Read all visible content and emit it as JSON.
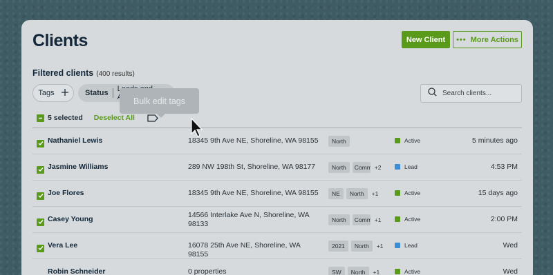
{
  "header": {
    "title": "Clients",
    "new_client_label": "New Client",
    "more_actions_label": "More Actions"
  },
  "filters": {
    "heading": "Filtered clients",
    "count": "(400 results)",
    "tags_label": "Tags",
    "status_key": "Status",
    "status_value": "Leads and Active"
  },
  "search": {
    "placeholder": "Search clients..."
  },
  "tooltip": {
    "text": "Bulk edit tags"
  },
  "selection": {
    "count_label": "5 selected",
    "deselect_label": "Deselect All"
  },
  "colors": {
    "accent": "#5a9a1a",
    "active": "#5a9a1a",
    "lead": "#3b8ed6"
  },
  "rows": [
    {
      "name": "Nathaniel Lewis",
      "address": "18345 9th Ave NE, Shoreline, WA 98155",
      "tags": [
        "North"
      ],
      "more": "",
      "status": "Active",
      "time": "5 minutes ago",
      "selected": true
    },
    {
      "name": "Jasmine Williams",
      "address": "289 NW 198th St, Shoreline, WA 98177",
      "tags": [
        "North",
        "Comm"
      ],
      "more": "+2",
      "status": "Lead",
      "time": "4:53 PM",
      "selected": true
    },
    {
      "name": "Joe Flores",
      "address": "18345 9th Ave NE, Shoreline, WA 98155",
      "tags": [
        "NE",
        "North"
      ],
      "more": "+1",
      "status": "Active",
      "time": "15 days ago",
      "selected": true
    },
    {
      "name": "Casey Young",
      "address": "14566 Interlake Ave N, Shoreline, WA 98133",
      "tags": [
        "North",
        "Comm"
      ],
      "more": "+1",
      "status": "Active",
      "time": "2:00 PM",
      "selected": true
    },
    {
      "name": "Vera Lee",
      "address": "16078 25th Ave NE, Shoreline, WA 98155",
      "tags": [
        "2021",
        "North"
      ],
      "more": "+1",
      "status": "Lead",
      "time": "Wed",
      "selected": true
    },
    {
      "name": "Robin Schneider",
      "address": "0 properties",
      "tags": [
        "SW",
        "North"
      ],
      "more": "+1",
      "status": "Active",
      "time": "Wed",
      "selected": false
    }
  ]
}
